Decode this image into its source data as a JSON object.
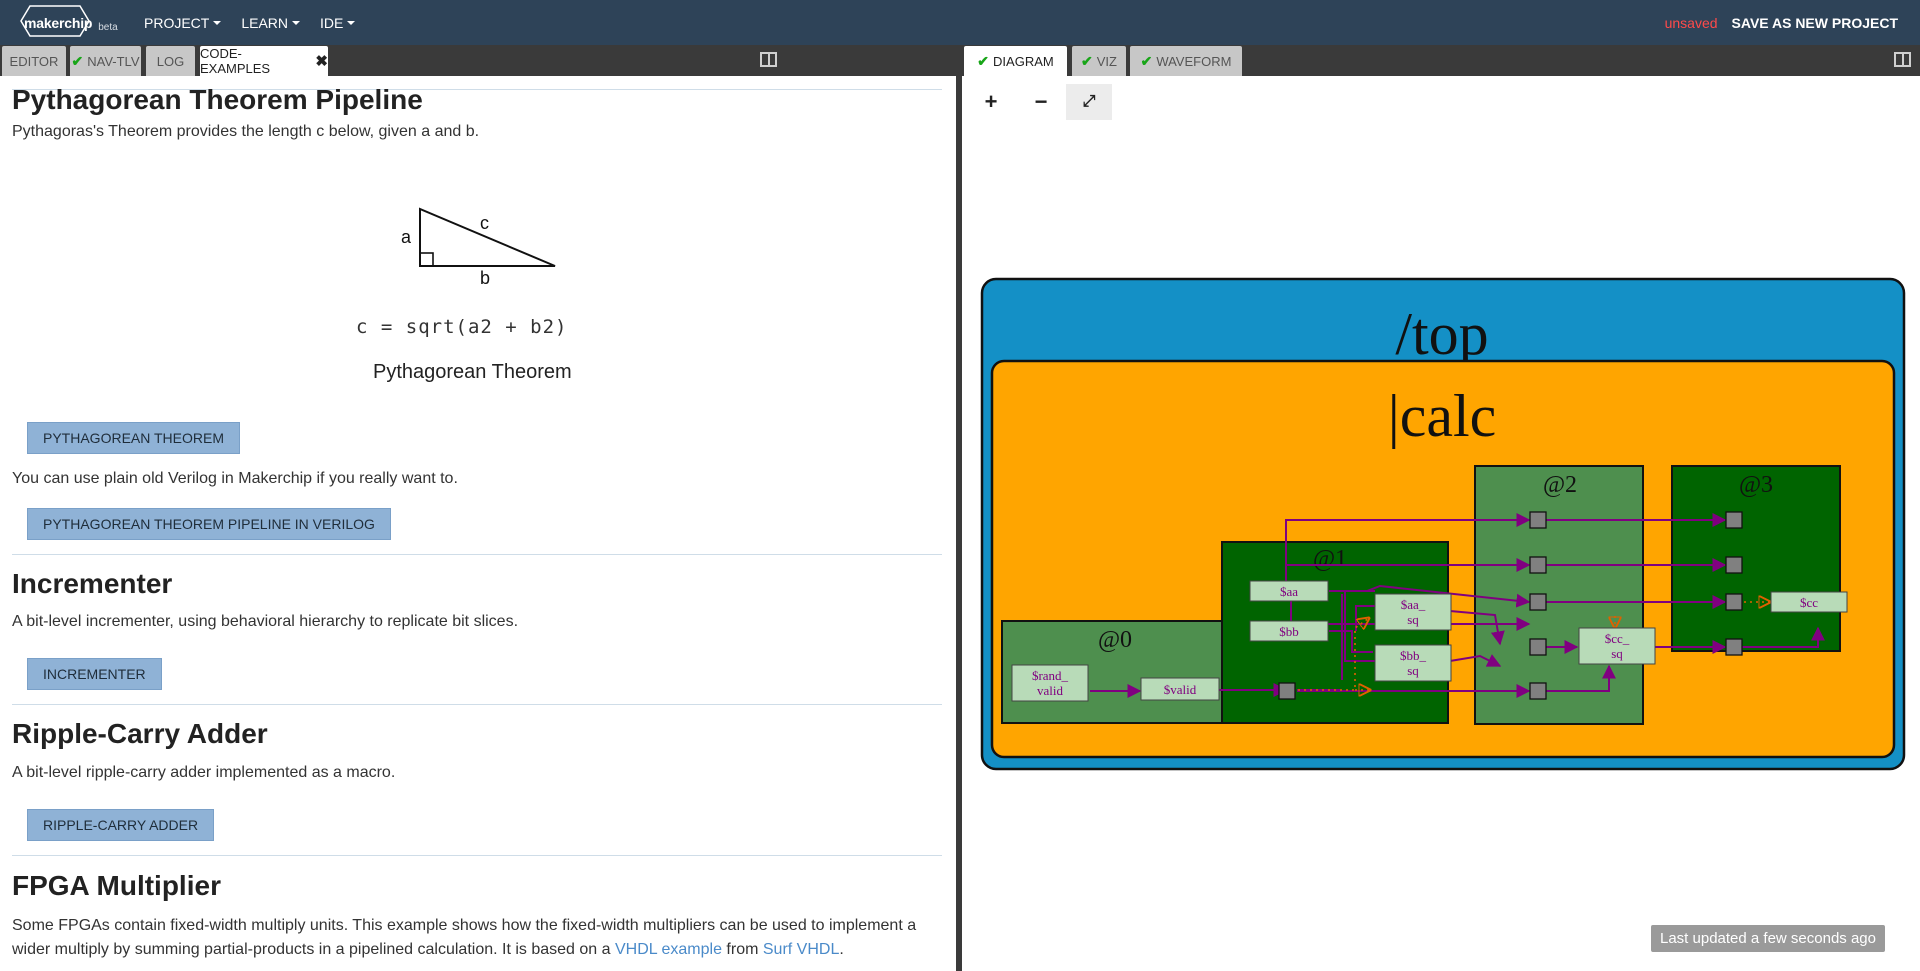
{
  "nav": {
    "logo_text": "makerchip",
    "logo_beta": "beta",
    "menu": [
      "PROJECT",
      "LEARN",
      "IDE"
    ],
    "unsaved": "unsaved",
    "save_new": "SAVE AS NEW PROJECT"
  },
  "left_tabs": [
    "EDITOR",
    "NAV-TLV",
    "LOG",
    "CODE-EXAMPLES"
  ],
  "right_tabs": [
    "DIAGRAM",
    "VIZ",
    "WAVEFORM"
  ],
  "content": {
    "pythag_title": "Pythagorean Theorem Pipeline",
    "pythag_desc": "Pythagoras's Theorem provides the length c below, given a and b.",
    "tri_a": "a",
    "tri_b": "b",
    "tri_c": "c",
    "formula": "c = sqrt(a2 + b2)",
    "caption": "Pythagorean Theorem",
    "btn_pythag": "PYTHAGOREAN THEOREM",
    "verilog_desc": "You can use plain old Verilog in Makerchip if you really want to.",
    "btn_pythag_verilog": "PYTHAGOREAN THEOREM PIPELINE IN VERILOG",
    "inc_title": "Incrementer",
    "inc_desc": "A bit-level incrementer, using behavioral hierarchy to replicate bit slices.",
    "btn_inc": "INCREMENTER",
    "rca_title": "Ripple-Carry Adder",
    "rca_desc": "A bit-level ripple-carry adder implemented as a macro.",
    "btn_rca": "RIPPLE-CARRY ADDER",
    "fpga_title": "FPGA Multiplier",
    "fpga_desc_1": "Some FPGAs contain fixed-width multiply units. This example shows how the fixed-width multipliers can be used to implement a",
    "fpga_desc_2a": "wider multiply by summing partial-products in a pipelined calculation. It is based on a ",
    "fpga_link_1": "VHDL example",
    "fpga_desc_2b": " from ",
    "fpga_link_2": "Surf VHDL",
    "fpga_desc_2c": "."
  },
  "diagram": {
    "zoom_in": "+",
    "zoom_out": "−",
    "fit": "⤢",
    "top_label": "/top",
    "calc_label": "|calc",
    "stages": [
      "@0",
      "@1",
      "@2",
      "@3"
    ],
    "signals": {
      "rand_valid_1": "$rand_",
      "rand_valid_2": "valid",
      "valid": "$valid",
      "aa": "$aa",
      "bb": "$bb",
      "aa_sq_1": "$aa_",
      "aa_sq_2": "sq",
      "bb_sq_1": "$bb_",
      "bb_sq_2": "sq",
      "cc_sq_1": "$cc_",
      "cc_sq_2": "sq",
      "cc": "$cc"
    },
    "colors": {
      "top_bg": "#1490c6",
      "calc_bg": "#ffa500",
      "stage_light": "#4e8f4e",
      "stage_dark": "#006400",
      "wire": "#800080",
      "node": "#b8dbb8"
    }
  },
  "status": "Last updated a few seconds ago"
}
